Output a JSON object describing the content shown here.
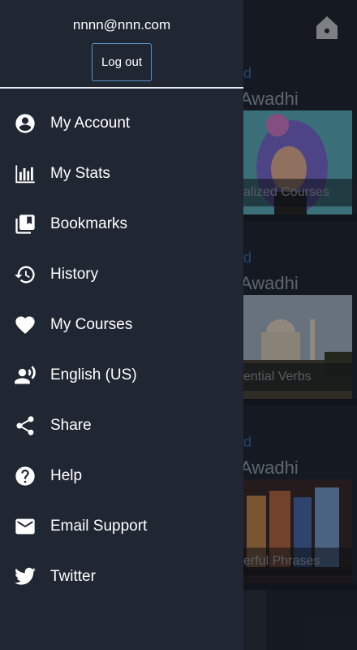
{
  "drawer": {
    "user_email": "nnnn@nnn.com",
    "logout_label": "Log out",
    "menu": [
      {
        "label": "My Account",
        "icon": "account-icon"
      },
      {
        "label": "My Stats",
        "icon": "stats-icon"
      },
      {
        "label": "Bookmarks",
        "icon": "bookmarks-icon"
      },
      {
        "label": "History",
        "icon": "history-icon"
      },
      {
        "label": "My Courses",
        "icon": "heart-icon"
      },
      {
        "label": "English (US)",
        "icon": "voice-icon"
      },
      {
        "label": "Share",
        "icon": "share-icon"
      },
      {
        "label": "Help",
        "icon": "help-icon"
      },
      {
        "label": "Email Support",
        "icon": "mail-icon"
      },
      {
        "label": "Twitter",
        "icon": "twitter-icon"
      }
    ]
  },
  "background": {
    "cards": [
      {
        "kicker": "d",
        "language": "Awadhi",
        "label": "alized Courses"
      },
      {
        "kicker": "d",
        "language": "Awadhi",
        "label": "ential Verbs"
      },
      {
        "kicker": "d",
        "language": "Awadhi",
        "label": "erful Phrases"
      }
    ]
  },
  "colors": {
    "drawer_bg": "#202733",
    "accent_border": "#5a93c9",
    "text": "#ffffff"
  }
}
